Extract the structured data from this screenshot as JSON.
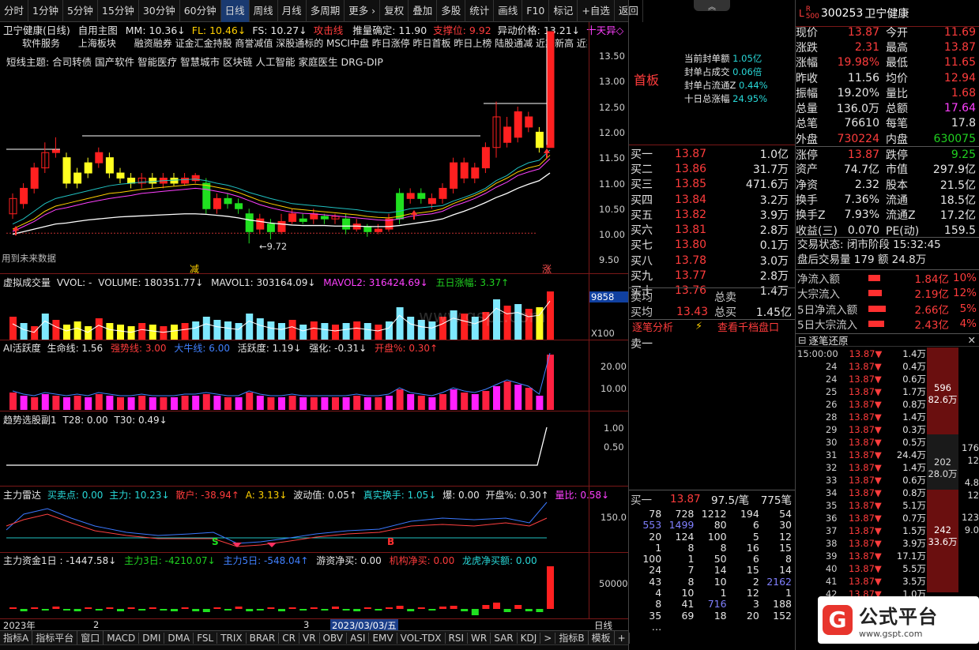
{
  "toolbar": {
    "items": [
      "分时",
      "1分钟",
      "5分钟",
      "15分钟",
      "30分钟",
      "60分钟",
      "日线",
      "周线",
      "月线",
      "多周期",
      "更多 ›",
      "复权",
      "叠加",
      "多股",
      "统计",
      "画线",
      "F10",
      "标记",
      "+自选",
      "返回"
    ]
  },
  "main": {
    "title": "卫宁健康(日线)",
    "subtitle": "自用主图",
    "ma": {
      "mm": "MM: 10.36↓",
      "fl": "FL: 10.46↓",
      "fs": "FS: 10.27↓",
      "atk": "攻击线",
      "trend": "推量确定: 11.90",
      "sup": "支撑位: 9.92",
      "abn": "异动价格: 13.21↓",
      "tianyu": "十天异◇"
    },
    "tags_row1": "软件服务      上海板块      融资融券 证金汇金持股 商誉减值 深股通标的 MSCI中盘 昨日涨停 昨日首板 昨日上榜 陆股通减 近期新高 近期",
    "tags_row2": "短线主题: 合司转债 国产软件 智能医疗 智慧城市 区块链 人工智能 家庭医生 DRG-DIP",
    "future": "用到未来数据",
    "low_label": "←9.72",
    "jian": "减",
    "zhang": "涨",
    "y_ticks": [
      "13.50",
      "13.00",
      "12.50",
      "12.00",
      "11.50",
      "11.00",
      "10.50",
      "10.00",
      "9.50"
    ]
  },
  "vol": {
    "name": "虚拟成交量",
    "vvol": "VVOL: -",
    "volume": "VOLUME: 180351.77↓",
    "mavol1": "MAVOL1: 303164.09↓",
    "mavol2": "MAVOL2: 316424.69↓",
    "wuri": "五日涨幅: 3.37↑",
    "tag": "9858",
    "x100": "X100",
    "wm": "www.gspt.com"
  },
  "ai": {
    "name": "AI活跃度",
    "smx": "生命线: 1.56",
    "qsx": "强势线: 3.00",
    "dnx": "大牛线: 6.00",
    "hyd": "活跃度: 1.19↓",
    "qh": "强化: -0.31↓",
    "kp": "开盘%: 0.30↑",
    "y1": "20.00",
    "y2": "10.00"
  },
  "trend": {
    "name": "趋势选股副1",
    "t28": "T28: 0.00",
    "t30": "T30: 0.49↓",
    "y1": "1.00",
    "y2": "0.50"
  },
  "radar": {
    "name": "主力雷达",
    "mmd": "买卖点: 0.00",
    "zl": "主力: 10.23↓",
    "sh": "散户: -38.94↑",
    "a": "A: 3.13↓",
    "bd": "波动值: 0.05↑",
    "zs": "真实换手: 1.05↓",
    "bao": "爆: 0.00",
    "kp": "开盘%: 0.30↑",
    "lb": "量比: 0.58↓",
    "y1": "150.0",
    "s": "S",
    "b": "B"
  },
  "fund": {
    "name": "主力资金1日",
    "v1": ": -1447.58↓",
    "v3": "主力3日: -4210.07↓",
    "v5": "主力5日: -548.04↑",
    "yz": "游资净买: 0.00",
    "jg": "机构净买: 0.00",
    "lh": "龙虎净买额: 0.00",
    "y1": "50000"
  },
  "xaxis": {
    "a": "2023年",
    "b": "2",
    "c": "3",
    "d": "2023/03/03/五",
    "e": "日线"
  },
  "bottom": {
    "items": [
      "指标A",
      "指标平台",
      "窗口",
      "MACD",
      "DMI",
      "DMA",
      "FSL",
      "TRIX",
      "BRAR",
      "CR",
      "VR",
      "OBV",
      "ASI",
      "EMV",
      "VOL-TDX",
      "RSI",
      "WR",
      "SAR",
      "KDJ",
      ">",
      "指标B",
      "模板",
      "+"
    ]
  },
  "mid": {
    "shouban": "首板",
    "seal": [
      {
        "k": "当前封单额",
        "v": "1.05亿"
      },
      {
        "k": "封单占成交",
        "v": "0.06倍"
      },
      {
        "k": "封单占流通Z",
        "v": "0.44%"
      },
      {
        "k": "十日总涨幅",
        "v": "24.95%"
      }
    ],
    "book": [
      {
        "k": "买一",
        "p": "13.87",
        "q": "1.0亿"
      },
      {
        "k": "买二",
        "p": "13.86",
        "q": "31.7万"
      },
      {
        "k": "买三",
        "p": "13.85",
        "q": "471.6万"
      },
      {
        "k": "买四",
        "p": "13.84",
        "q": "3.2万"
      },
      {
        "k": "买五",
        "p": "13.82",
        "q": "3.9万"
      },
      {
        "k": "买六",
        "p": "13.81",
        "q": "2.8万"
      },
      {
        "k": "买七",
        "p": "13.80",
        "q": "0.1万"
      },
      {
        "k": "买八",
        "p": "13.78",
        "q": "3.0万"
      },
      {
        "k": "买九",
        "p": "13.77",
        "q": "2.8万"
      },
      {
        "k": "买十",
        "p": "13.76",
        "q": "1.4万"
      }
    ],
    "avg_sell": "卖均",
    "avg_buy": "买均",
    "avg_buy_p": "13.43",
    "zm": "总卖",
    "zb": "总买",
    "zb_v": "1.45亿",
    "tab1": "逐笔分析",
    "tab2": "查看千档盘口",
    "sell1": "卖一",
    "b1": {
      "k": "买一",
      "p": "13.87",
      "r": "97.5/笔",
      "n": "775笔"
    },
    "grid": [
      [
        "78",
        "728",
        "1212",
        "194",
        "54"
      ],
      [
        "553",
        "1499",
        "80",
        "6",
        "30"
      ],
      [
        "20",
        "124",
        "100",
        "5",
        "12"
      ],
      [
        "1",
        "8",
        "8",
        "16",
        "15"
      ],
      [
        "100",
        "1",
        "50",
        "6",
        "8"
      ],
      [
        "24",
        "7",
        "14",
        "15",
        "14"
      ],
      [
        "43",
        "8",
        "10",
        "2",
        "2162"
      ],
      [
        "4",
        "10",
        "1",
        "12",
        "1"
      ],
      [
        "8",
        "41",
        "716",
        "3",
        "188"
      ],
      [
        "35",
        "69",
        "18",
        "20",
        "152"
      ],
      [
        "…",
        "",
        "",
        "",
        ""
      ]
    ]
  },
  "right": {
    "code": "300253",
    "name": "卫宁健康",
    "rows": [
      {
        "k": "现价",
        "v": "13.87",
        "c": "red",
        "k2": "今开",
        "v2": "11.69",
        "c2": "red"
      },
      {
        "k": "涨跌",
        "v": "2.31",
        "c": "red",
        "k2": "最高",
        "v2": "13.87",
        "c2": "red"
      },
      {
        "k": "涨幅",
        "v": "19.98%",
        "c": "red",
        "k2": "最低",
        "v2": "11.65",
        "c2": "red"
      },
      {
        "k": "昨收",
        "v": "11.56",
        "c": "wht",
        "k2": "均价",
        "v2": "12.94",
        "c2": "red"
      },
      {
        "k": "振幅",
        "v": "19.20%",
        "c": "wht",
        "k2": "量比",
        "v2": "1.68",
        "c2": "red"
      },
      {
        "k": "总量",
        "v": "136.0万",
        "c": "wht",
        "k2": "总额",
        "v2": "17.64",
        "c2": "mag"
      },
      {
        "k": "总笔",
        "v": "76610",
        "c": "wht",
        "k2": "每笔",
        "v2": "17.8",
        "c2": "wht"
      },
      {
        "k": "外盘",
        "v": "730224",
        "c": "red",
        "k2": "内盘",
        "v2": "630075",
        "c2": "grn"
      },
      {
        "k": "涨停",
        "v": "13.87",
        "c": "red",
        "k2": "跌停",
        "v2": "9.25",
        "c2": "grn"
      },
      {
        "k": "资产",
        "v": "74.7亿",
        "c": "wht",
        "k2": "市值",
        "v2": "297.9亿",
        "c2": "wht"
      },
      {
        "k": "净资",
        "v": "2.32",
        "c": "wht",
        "k2": "股本",
        "v2": "21.5亿",
        "c2": "wht"
      },
      {
        "k": "换手",
        "v": "7.36%",
        "c": "wht",
        "k2": "流通",
        "v2": "18.5亿",
        "c2": "wht"
      },
      {
        "k": "换手Z",
        "v": "7.93%",
        "c": "wht",
        "k2": "流通Z",
        "v2": "17.2亿",
        "c2": "wht"
      },
      {
        "k": "收益(三)",
        "v": "0.070",
        "c": "wht",
        "k2": "PE(动)",
        "v2": "159.5",
        "c2": "wht"
      }
    ],
    "status": "交易状态: 闭市阶段  15:32:45",
    "after": "盘后交易量 179 额 24.8万",
    "flows": [
      {
        "k": "净流入额",
        "v": "1.84亿",
        "p": "10%",
        "w": 0.55
      },
      {
        "k": "大宗流入",
        "v": "2.19亿",
        "p": "12%",
        "w": 0.62
      },
      {
        "k": "5日净流入额",
        "v": "2.66亿",
        "p": "5%",
        "w": 0.78
      },
      {
        "k": "5日大宗流入",
        "v": "2.43亿",
        "p": "4%",
        "w": 0.72
      }
    ],
    "zbtitle": "逐笔还原",
    "ticks": [
      [
        "15:00:00",
        "13.87▼",
        "1.4万"
      ],
      [
        "24",
        "13.87▼",
        "0.4万"
      ],
      [
        "24",
        "13.87▼",
        "0.6万"
      ],
      [
        "25",
        "13.87▼",
        "1.7万"
      ],
      [
        "26",
        "13.87▼",
        "0.8万"
      ],
      [
        "28",
        "13.87▼",
        "1.4万"
      ],
      [
        "29",
        "13.87▼",
        "0.3万"
      ],
      [
        "30",
        "13.87▼",
        "0.5万"
      ],
      [
        "31",
        "13.87▼",
        "24.4万"
      ],
      [
        "32",
        "13.87▼",
        "1.4万"
      ],
      [
        "33",
        "13.87▼",
        "0.6万"
      ],
      [
        "34",
        "13.87▼",
        "0.8万"
      ],
      [
        "35",
        "13.87▼",
        "5.1万"
      ],
      [
        "36",
        "13.87▼",
        "0.7万"
      ],
      [
        "37",
        "13.87▼",
        "1.5万"
      ],
      [
        "38",
        "13.87▼",
        "3.9万"
      ],
      [
        "39",
        "13.87▼",
        "17.1万"
      ],
      [
        "40",
        "13.87▼",
        "5.5万"
      ],
      [
        "41",
        "13.87▼",
        "3.5万"
      ],
      [
        "42",
        "13.87▼",
        "1.0万"
      ]
    ],
    "blk1": {
      "a": "596",
      "b": "82.6万"
    },
    "blk2": {
      "a": "202",
      "b": "28.0万"
    },
    "blk3": {
      "a": "242",
      "b": "33.6万"
    },
    "side": [
      "176",
      "12",
      "4.8",
      "12",
      "123",
      "9.0"
    ],
    "logo": "公式平台",
    "url": "www.gspt.com"
  }
}
